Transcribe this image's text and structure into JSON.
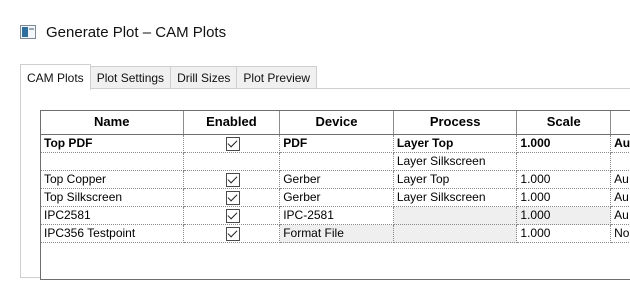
{
  "window": {
    "title": "Generate Plot – CAM Plots"
  },
  "tabs": [
    {
      "label": "CAM Plots",
      "active": true
    },
    {
      "label": "Plot Settings",
      "active": false
    },
    {
      "label": "Drill Sizes",
      "active": false
    },
    {
      "label": "Plot Preview",
      "active": false
    }
  ],
  "table": {
    "columns": [
      "Name",
      "Enabled",
      "Device",
      "Process",
      "Scale",
      ""
    ],
    "rows": [
      {
        "name": "Top PDF",
        "enabled": true,
        "device": "PDF",
        "process": "Layer Top",
        "scale": "1.000",
        "extra": "Au"
      },
      {
        "name": "",
        "enabled": null,
        "device": "",
        "process": "Layer Silkscreen",
        "scale": "",
        "extra": ""
      },
      {
        "name": "Top Copper",
        "enabled": true,
        "device": "Gerber",
        "process": "Layer Top",
        "scale": "1.000",
        "extra": "Au"
      },
      {
        "name": "Top Silkscreen",
        "enabled": true,
        "device": "Gerber",
        "process": "Layer Silkscreen",
        "scale": "1.000",
        "extra": "Au"
      },
      {
        "name": "IPC2581",
        "enabled": true,
        "device": "IPC-2581",
        "process": "",
        "scale": "1.000",
        "extra": "Au"
      },
      {
        "name": "IPC356 Testpoint",
        "enabled": true,
        "device": "Format File",
        "process": "",
        "scale": "1.000",
        "extra": "No"
      }
    ]
  }
}
